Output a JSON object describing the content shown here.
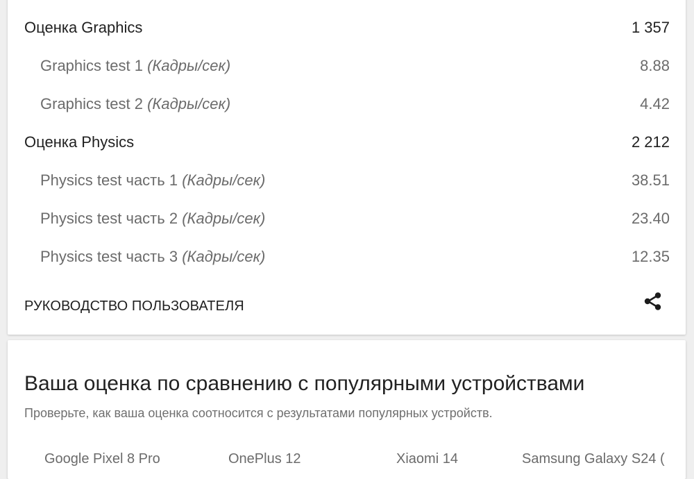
{
  "scores": {
    "graphics": {
      "label": "Оценка Graphics",
      "value": "1 357",
      "tests": [
        {
          "name": "Graphics test 1",
          "unit": "(Кадры/сек)",
          "value": "8.88"
        },
        {
          "name": "Graphics test 2",
          "unit": "(Кадры/сек)",
          "value": "4.42"
        }
      ]
    },
    "physics": {
      "label": "Оценка Physics",
      "value": "2 212",
      "tests": [
        {
          "name": "Physics test часть 1",
          "unit": "(Кадры/сек)",
          "value": "38.51"
        },
        {
          "name": "Physics test часть 2",
          "unit": "(Кадры/сек)",
          "value": "23.40"
        },
        {
          "name": "Physics test часть 3",
          "unit": "(Кадры/сек)",
          "value": "12.35"
        }
      ]
    }
  },
  "footer": {
    "guide_label": "РУКОВОДСТВО ПОЛЬЗОВАТЕЛЯ",
    "share_icon": "share-icon"
  },
  "comparison": {
    "title": "Ваша оценка по сравнению с популярными устройствами",
    "subtitle": "Проверьте, как ваша оценка соотносится с результатами популярных устройств.",
    "devices": [
      "Google Pixel 8 Pro",
      "OnePlus 12",
      "Xiaomi 14",
      "Samsung Galaxy S24 ("
    ]
  }
}
